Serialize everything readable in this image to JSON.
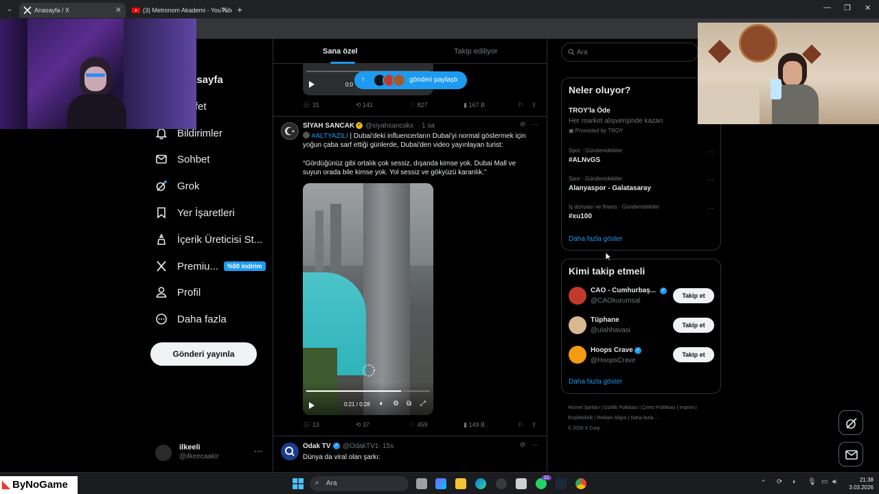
{
  "browser": {
    "tabs": [
      {
        "title": "Anasayfa / X",
        "close": "✕"
      },
      {
        "title": "(3) Metronom Akademi - YouTube",
        "close": "✕"
      }
    ],
    "new_tab": "+",
    "window_controls": [
      "—",
      "❐",
      "✕"
    ]
  },
  "nav": {
    "items": [
      {
        "label": "Anasayfa",
        "icon": "home-icon"
      },
      {
        "label": "Keşfet",
        "icon": "search-icon"
      },
      {
        "label": "Bildirimler",
        "icon": "bell-icon"
      },
      {
        "label": "Sohbet",
        "icon": "mail-icon"
      },
      {
        "label": "Grok",
        "icon": "grok-icon"
      },
      {
        "label": "Yer İşaretleri",
        "icon": "bookmark-icon"
      },
      {
        "label": "İçerik Üreticisi St...",
        "icon": "creator-studio-icon"
      },
      {
        "label": "Premiu...",
        "icon": "x-logo-icon",
        "badge": "%50 indirim"
      },
      {
        "label": "Profil",
        "icon": "profile-icon"
      },
      {
        "label": "Daha fazla",
        "icon": "more-circle-icon"
      }
    ],
    "post_button": "Gönderi yayınla",
    "account": {
      "name": "ilkeeli",
      "handle": "@ilkeecaakir",
      "more": "···"
    }
  },
  "feed": {
    "tabs": [
      "Sana özel",
      "Takip ediliyor"
    ],
    "share_pill": "gönderi paylaştı",
    "first_post_video_time": "0:0",
    "first_post_actions": {
      "replies": "31",
      "reposts": "141",
      "likes": "827",
      "views": "167 B"
    },
    "tweet": {
      "name": "SİYAH SANCAK",
      "handle": "@siyahsancakx",
      "time": "· 1 sa",
      "hashtag": "#ALTYAZILI",
      "text_1": "| Dubai'deki influencerların Dubai'yi normal göstermek için yoğun çaba sarf ettiği günlerde, Dubai'den video yayınlayan turist:",
      "text_2": "“Gördüğünüz gibi ortalık çok sessiz, dışanda kimse yok. Dubai Mall ve suyun orada bile kimse yok. Yol sessiz ve gökyüzü karanlık.”",
      "video_time": "0:21 / 0:28",
      "actions": {
        "replies": "13",
        "reposts": "37",
        "likes": "459",
        "views": "149 B"
      }
    },
    "next_tweet": {
      "name": "Odak TV",
      "handle": "@OdakTV1",
      "time": "· 15s",
      "text": "Dünya da viral olan şarkı:"
    }
  },
  "right": {
    "search_placeholder": "Ara",
    "trends_title": "Neler oluyor?",
    "promo": {
      "name": "TROY'la Öde",
      "desc": "Her market alışverişinde kazan",
      "promoted": "Promoted by TROY"
    },
    "trends": [
      {
        "meta": "Spor · Gündemdekiler",
        "name": "#ALNvGS"
      },
      {
        "meta": "Spor · Gündemdekiler",
        "name": "Alanyaspor - Galatasaray"
      },
      {
        "meta": "İş dünyası ve finans · Gündemdekiler",
        "name": "#xu100"
      }
    ],
    "trends_more": "Daha fazla göster",
    "who_title": "Kimi takip etmeli",
    "who": [
      {
        "name": "CAO - Cumhurbaş...",
        "handle": "@CAOkurumsal",
        "button": "Takip et"
      },
      {
        "name": "Tüphane",
        "handle": "@ulahhavasi",
        "button": "Takip et"
      },
      {
        "name": "Hoops Crave",
        "handle": "@HoopsCrave",
        "button": "Takip et"
      }
    ],
    "who_more": "Daha fazla göster",
    "footer": [
      "Hizmet Şartları",
      "Gizlilik Politikası",
      "Çerez Politikası",
      "İmprint",
      "Erişilebilirlik",
      "Reklam bilgisi",
      "Daha fazla ···",
      "© 2026 X Corp."
    ]
  },
  "taskbar": {
    "search": "Ara",
    "time": "21:38",
    "date": "3.03.2026",
    "whatsapp_badge": "21"
  },
  "overlay": {
    "brand": "ByNoGame"
  },
  "colors": {
    "accent": "#1d9bf0",
    "background": "#000000",
    "border": "#2f3336",
    "muted": "#71767b"
  }
}
